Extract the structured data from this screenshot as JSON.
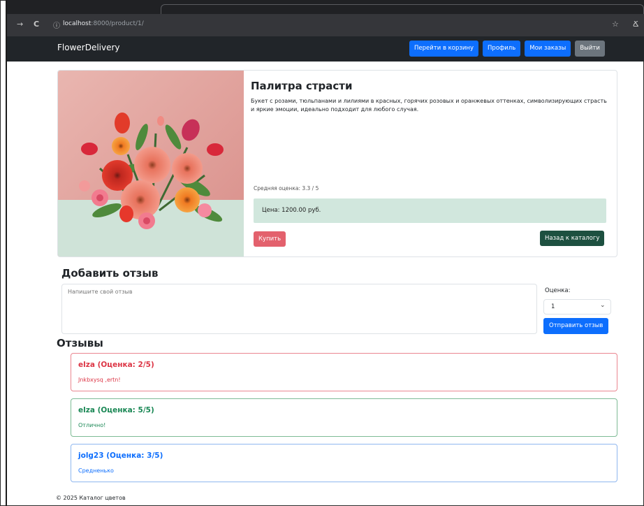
{
  "browser": {
    "back_icon": "→",
    "reload_icon": "C",
    "info_icon": "ⓘ",
    "url_host": "localhost",
    "url_path": ":8000/product/1/",
    "star_icon": "☆",
    "profile_icon": "Ճ"
  },
  "navbar": {
    "brand": "FlowerDelivery",
    "buttons": [
      "Перейти в корзину",
      "Профиль",
      "Мои заказы",
      "Выйти"
    ]
  },
  "product": {
    "title": "Палитра страсти",
    "description": "Букет с розами, тюльпанами и лилиями в красных, горячих розовых и оранжевых оттенках, символизирующих страсть и яркие эмоции, идеально подходит для любого случая.",
    "rating_text": "Средняя оценка: 3.3 / 5",
    "price_text": "Цена: 1200.00 руб.",
    "buy_label": "Купить",
    "back_label": "Назад к каталогу"
  },
  "review_form": {
    "title": "Добавить отзыв",
    "placeholder": "Напишите свой отзыв",
    "rating_label": "Оценка:",
    "rating_value": "1",
    "chevron_icon": "⌄",
    "submit_label": "Отправить отзыв"
  },
  "reviews": {
    "title": "Отзывы",
    "items": [
      {
        "user": "elza",
        "score": "(Оценка: 2/5)",
        "text": "Jnkbxysq ,ertn!",
        "color": "#dc3545"
      },
      {
        "user": "elza",
        "score": "(Оценка: 5/5)",
        "text": "Отлично!",
        "color": "#198754"
      },
      {
        "user": "jolg23",
        "score": "(Оценка: 3/5)",
        "text": "Средненько",
        "color": "#0d6efd"
      }
    ]
  },
  "footer": {
    "text": "© 2025 Каталог цветов"
  },
  "colors": {
    "navbar_bg": "#212529",
    "primary": "#0d6efd",
    "secondary": "#6c757d",
    "danger": "#dc3545",
    "success_dark": "#1d5040",
    "price_bg": "#d1e7dd"
  }
}
